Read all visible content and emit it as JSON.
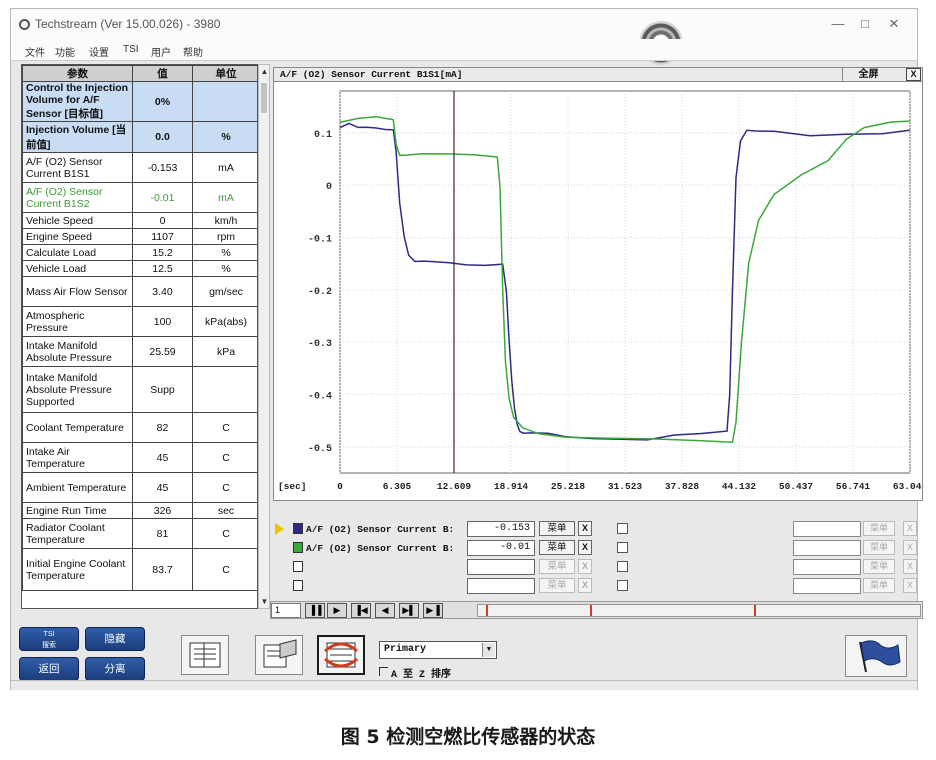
{
  "window": {
    "title": "Techstream (Ver 15.00.026) - 3980",
    "controls": [
      "—",
      "□",
      "✕"
    ]
  },
  "menu": [
    "文件",
    "功能",
    "设置",
    "TSI",
    "用户",
    "帮助"
  ],
  "params": {
    "headers": [
      "参数",
      "值",
      "单位"
    ],
    "rows": [
      {
        "name": "Control the Injection Volume for A/F Sensor [目标值]",
        "value": "0%",
        "unit": "",
        "style": "highlight"
      },
      {
        "name": "Injection Volume [当前值]",
        "value": "0.0",
        "unit": "%",
        "style": "highlight"
      },
      {
        "name": "A/F (O2) Sensor Current B1S1",
        "value": "-0.153",
        "unit": "mA",
        "style": "normal"
      },
      {
        "name": "A/F (O2) Sensor Current B1S2",
        "value": "-0.01",
        "unit": "mA",
        "style": "green"
      },
      {
        "name": "Vehicle Speed",
        "value": "0",
        "unit": "km/h",
        "style": "normal"
      },
      {
        "name": "Engine Speed",
        "value": "1107",
        "unit": "rpm",
        "style": "normal"
      },
      {
        "name": "Calculate Load",
        "value": "15.2",
        "unit": "%",
        "style": "normal"
      },
      {
        "name": "Vehicle Load",
        "value": "12.5",
        "unit": "%",
        "style": "normal"
      },
      {
        "name": "Mass Air Flow Sensor",
        "value": "3.40",
        "unit": "gm/sec",
        "style": "normal"
      },
      {
        "name": "Atmospheric Pressure",
        "value": "100",
        "unit": "kPa(abs)",
        "style": "normal"
      },
      {
        "name": "Intake Manifold Absolute Pressure",
        "value": "25.59",
        "unit": "kPa",
        "style": "normal"
      },
      {
        "name": "Intake Manifold Absolute Pressure Supported",
        "value": "Supp",
        "unit": "",
        "style": "normal"
      },
      {
        "name": "Coolant Temperature",
        "value": "82",
        "unit": "C",
        "style": "normal"
      },
      {
        "name": "Intake Air Temperature",
        "value": "45",
        "unit": "C",
        "style": "normal"
      },
      {
        "name": "Ambient Temperature",
        "value": "45",
        "unit": "C",
        "style": "normal"
      },
      {
        "name": "Engine Run Time",
        "value": "326",
        "unit": "sec",
        "style": "normal"
      },
      {
        "name": "Radiator Coolant Temperature",
        "value": "81",
        "unit": "C",
        "style": "normal"
      },
      {
        "name": "Initial Engine Coolant Temperature",
        "value": "83.7",
        "unit": "C",
        "style": "normal"
      }
    ]
  },
  "chart": {
    "header_title": "A/F (O2) Sensor Current B1S1[mA]",
    "fullscreen_label": "全屏",
    "close_label": "X",
    "xunit_label": "[sec]"
  },
  "chart_data": {
    "type": "line",
    "xlabel": "[sec]",
    "ylabel": "",
    "xlim": [
      0,
      63.046
    ],
    "ylim": [
      -0.55,
      0.18
    ],
    "xticks": [
      "0",
      "6.305",
      "12.609",
      "18.914",
      "25.218",
      "31.523",
      "37.828",
      "44.132",
      "50.437",
      "56.741",
      "63.046"
    ],
    "yticks": [
      "0.1",
      "0",
      "-0.1",
      "-0.2",
      "-0.3",
      "-0.4",
      "-0.5"
    ],
    "ytick_values": [
      0.1,
      0,
      -0.1,
      -0.2,
      -0.3,
      -0.4,
      -0.5
    ],
    "cursor_x": 12.609,
    "grid": true,
    "series": [
      {
        "name": "A/F (O2) Sensor Current B1S1",
        "color": "#2e2a84",
        "x": [
          0,
          1,
          2,
          3,
          4,
          5,
          5.9,
          6.2,
          6.6,
          7.1,
          7.6,
          8.3,
          9.3,
          10.5,
          12.1,
          14.0,
          16.0,
          18.0,
          18.4,
          18.7,
          19.0,
          19.3,
          19.6,
          19.9,
          20.3,
          21.0,
          23.0,
          25.0,
          28.0,
          31.0,
          34.0,
          37.0,
          40.0,
          42.8,
          43.1,
          43.4,
          43.8,
          44.3,
          45.0,
          46.0,
          48.0,
          52.0,
          56.0,
          60.0,
          63.0
        ],
        "y": [
          0.11,
          0.113,
          0.105,
          0.11,
          0.114,
          0.112,
          0.107,
          0.06,
          -0.04,
          -0.1,
          -0.13,
          -0.14,
          -0.143,
          -0.15,
          -0.154,
          -0.155,
          -0.15,
          -0.145,
          -0.2,
          -0.3,
          -0.38,
          -0.43,
          -0.455,
          -0.465,
          -0.47,
          -0.475,
          -0.48,
          -0.485,
          -0.483,
          -0.48,
          -0.482,
          -0.478,
          -0.48,
          -0.475,
          -0.4,
          -0.2,
          0.02,
          0.085,
          0.1,
          0.098,
          0.102,
          0.099,
          0.103,
          0.1,
          0.101
        ]
      },
      {
        "name": "A/F (O2) Sensor Current B1S2",
        "color": "#3aa83a",
        "x": [
          0,
          2,
          4,
          5.9,
          6.2,
          6.6,
          7.4,
          9,
          12,
          15,
          17.4,
          17.7,
          18.0,
          18.3,
          18.7,
          19.2,
          20.2,
          22.0,
          25.0,
          30.0,
          35.0,
          40.0,
          43.4,
          43.8,
          44.4,
          45.2,
          46.3,
          48.0,
          51.0,
          54.0,
          56.0,
          58.0,
          61.0,
          63.0
        ],
        "y": [
          0.12,
          0.125,
          0.128,
          0.125,
          0.08,
          0.06,
          0.058,
          0.058,
          0.057,
          0.057,
          0.056,
          0.0,
          -0.2,
          -0.34,
          -0.41,
          -0.445,
          -0.462,
          -0.472,
          -0.48,
          -0.485,
          -0.488,
          -0.49,
          -0.49,
          -0.45,
          -0.3,
          -0.15,
          -0.07,
          -0.02,
          0.02,
          0.05,
          0.09,
          0.11,
          0.118,
          0.12
        ]
      }
    ]
  },
  "data_rows": [
    {
      "label": "A/F (O2) Sensor Current B:",
      "value": "-0.153",
      "swatch": "#2e2a84",
      "menu": "菜单",
      "x": "X",
      "active": true
    },
    {
      "label": "A/F (O2) Sensor Current B:",
      "value": "-0.01",
      "swatch": "#3aa83a",
      "menu": "菜单",
      "x": "X",
      "active": true
    },
    {
      "label": "",
      "value": "",
      "swatch": "",
      "menu": "菜单",
      "x": "X",
      "active": false
    },
    {
      "label": "",
      "value": "",
      "swatch": "",
      "menu": "菜单",
      "x": "X",
      "active": false
    }
  ],
  "right_rows": [
    {
      "menu": "菜单",
      "x": "X"
    },
    {
      "menu": "菜单",
      "x": "X"
    },
    {
      "menu": "菜单",
      "x": "X"
    },
    {
      "menu": "菜单",
      "x": "X"
    }
  ],
  "playback": {
    "frame": "1",
    "buttons": [
      "▐▐",
      "▶",
      "▐◀",
      "◀",
      "▶▌",
      "▶▐"
    ]
  },
  "nav": {
    "tsi_small_top": "TSI",
    "tsi_small_bottom": "搜索",
    "hide": "隐藏",
    "back": "返回",
    "split": "分离"
  },
  "select": {
    "value": "Primary"
  },
  "sort": {
    "label": "A 至 Z 排序"
  },
  "caption": "图 5  检测空燃比传感器的状态"
}
